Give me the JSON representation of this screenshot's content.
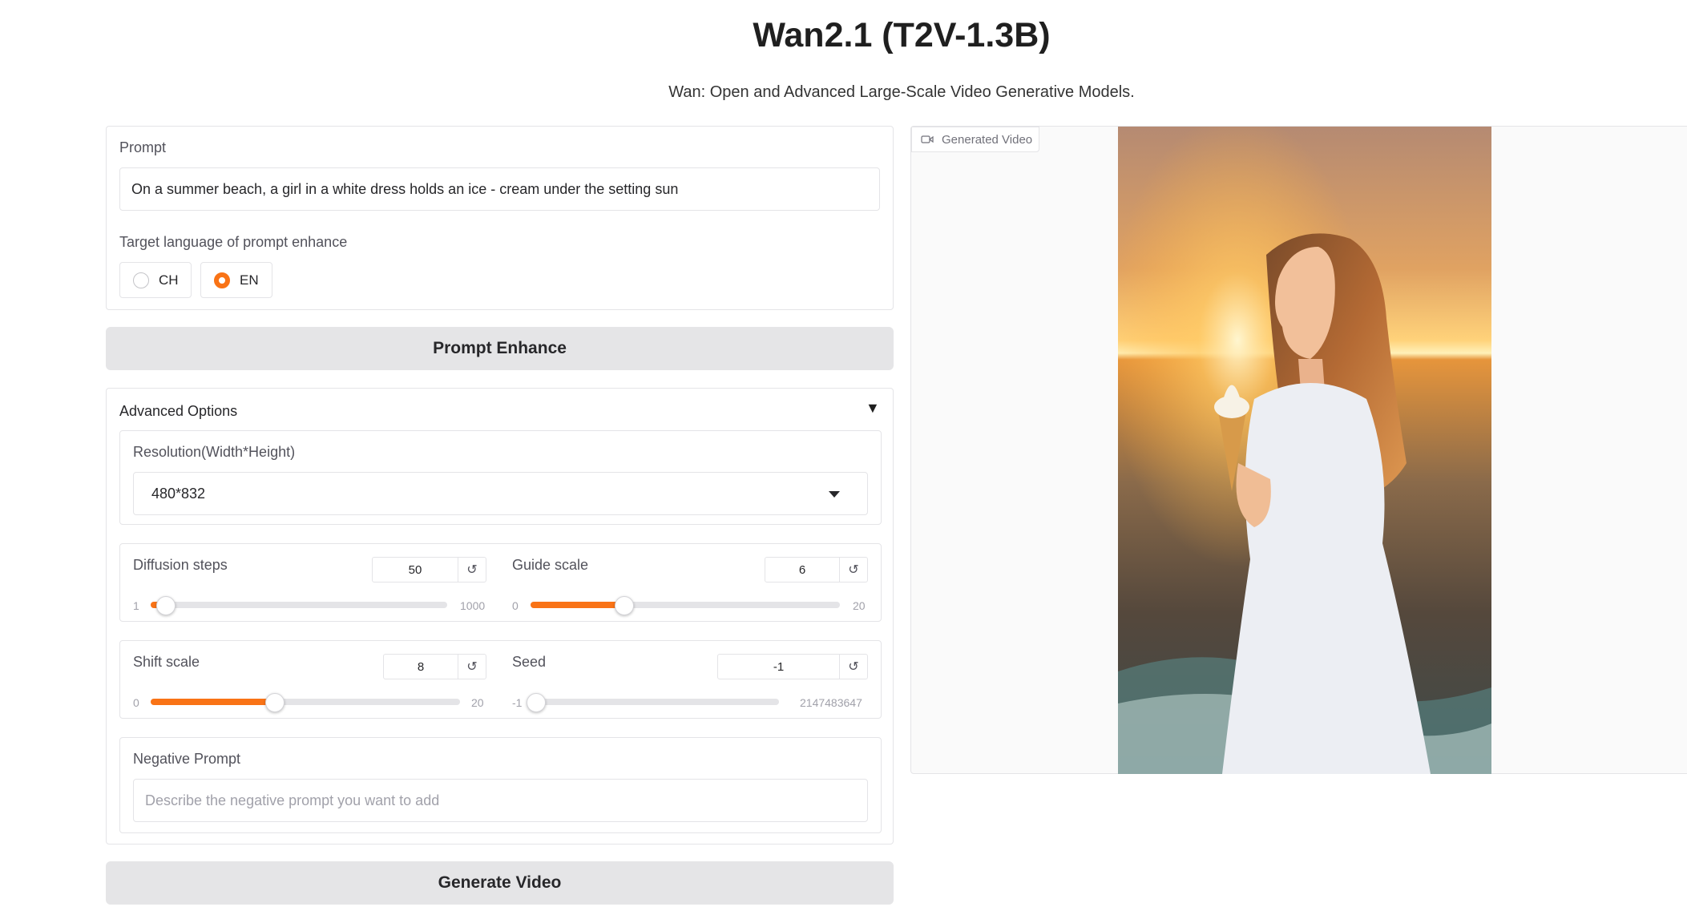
{
  "header": {
    "title": "Wan2.1 (T2V-1.3B)",
    "subtitle": "Wan: Open and Advanced Large-Scale Video Generative Models."
  },
  "prompt": {
    "label": "Prompt",
    "value": "On a summer beach, a girl in a white dress holds an ice - cream under the setting sun"
  },
  "language": {
    "label": "Target language of prompt enhance",
    "options": [
      "CH",
      "EN"
    ],
    "selected": "EN"
  },
  "buttons": {
    "enhance": "Prompt Enhance",
    "generate": "Generate Video"
  },
  "advanced": {
    "label": "Advanced Options",
    "toggle_icon": "▼",
    "resolution": {
      "label": "Resolution(Width*Height)",
      "value": "480*832"
    },
    "diffusion_steps": {
      "label": "Diffusion steps",
      "value": "50",
      "min": "1",
      "max": "1000",
      "fraction": 0.049
    },
    "guide_scale": {
      "label": "Guide scale",
      "value": "6",
      "min": "0",
      "max": "20",
      "fraction": 0.3
    },
    "shift_scale": {
      "label": "Shift scale",
      "value": "8",
      "min": "0",
      "max": "20",
      "fraction": 0.4
    },
    "seed": {
      "label": "Seed",
      "value": "-1",
      "min": "-1",
      "max": "2147483647",
      "fraction": 0.0
    },
    "negative_prompt": {
      "label": "Negative Prompt",
      "placeholder": "Describe the negative prompt you want to add"
    }
  },
  "output": {
    "label": "Generated Video",
    "icon": "video-camera-icon",
    "download_icon": "download-icon"
  },
  "colors": {
    "accent": "#f97316",
    "button_bg": "#e5e5e7",
    "border": "#e4e4e7"
  }
}
